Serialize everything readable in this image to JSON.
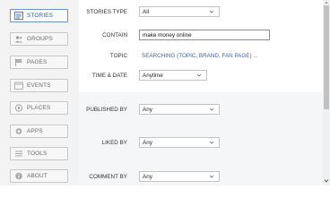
{
  "sidebar": {
    "items": [
      {
        "label": "STORIES",
        "icon": "stories-icon",
        "active": true
      },
      {
        "label": "GROUPS",
        "icon": "groups-icon",
        "active": false
      },
      {
        "label": "PAGES",
        "icon": "pages-icon",
        "active": false
      },
      {
        "label": "EVENTS",
        "icon": "events-icon",
        "active": false
      },
      {
        "label": "PLACES",
        "icon": "places-icon",
        "active": false
      },
      {
        "label": "APPS",
        "icon": "apps-icon",
        "active": false
      },
      {
        "label": "TOOLS",
        "icon": "tools-icon",
        "active": false
      },
      {
        "label": "ABOUT",
        "icon": "about-icon",
        "active": false
      }
    ]
  },
  "form": {
    "stories_type": {
      "label": "STORIES TYPE",
      "value": "All"
    },
    "contain": {
      "label": "CONTAIN",
      "value": "make money online"
    },
    "topic": {
      "label": "TOPIC",
      "link": "SEARCHING (TOPIC, BRAND, FAN PAGE) ..."
    },
    "time_date": {
      "label": "TIME & DATE",
      "value": "Anytime"
    },
    "published_by": {
      "label": "PUBLISHED BY",
      "value": "Any"
    },
    "liked_by": {
      "label": "LIKED BY",
      "value": "Any"
    },
    "comment_by": {
      "label": "COMMENT BY",
      "value": "Any"
    }
  },
  "colors": {
    "active_nav_border": "#6e93c8",
    "active_nav_text": "#3d5f95",
    "link": "#3a66a9"
  }
}
